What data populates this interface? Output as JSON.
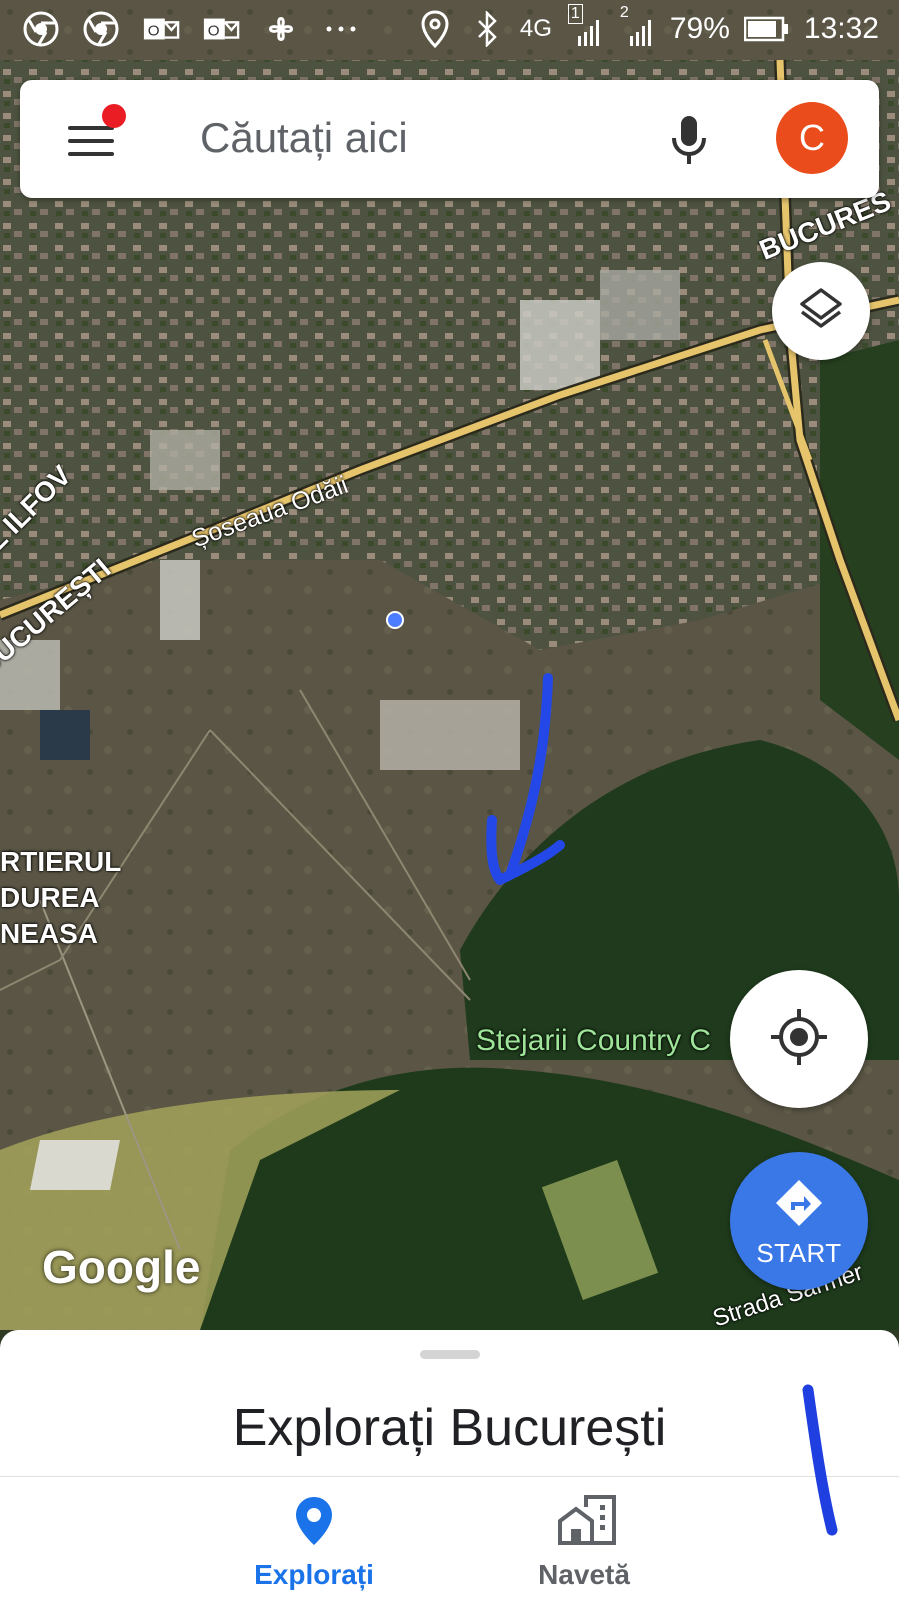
{
  "status_bar": {
    "battery": "79%",
    "time": "13:32",
    "network": "4G",
    "sim1": "1",
    "sim2": "2",
    "left_icons": [
      "chrome-icon",
      "chrome-icon",
      "outlook-icon",
      "outlook-icon",
      "pinwheel-icon",
      "more-dots-icon"
    ],
    "right_icons": [
      "location-icon",
      "bluetooth-icon",
      "signal-icon",
      "battery-icon"
    ]
  },
  "search": {
    "placeholder": "Căutați aici",
    "avatar_letter": "C",
    "menu_notification": true
  },
  "map": {
    "labels": {
      "road_odaii": "Șoseaua Odăii",
      "ilfov": "UL ILFOV",
      "bucuresti_left": "BUCUREȘTI",
      "bucuresti_top": "BUCURES",
      "cartier_line1": "RTIERUL",
      "cartier_line2": "DUREA",
      "cartier_line3": "NEASA",
      "stejarii": "Stejarii Country C",
      "strada": "Strada Sarmer"
    },
    "logo": "Google"
  },
  "buttons": {
    "start_label": "START"
  },
  "sheet": {
    "title": "Explorați București"
  },
  "nav": {
    "explore_label": "Explorați",
    "commute_label": "Navetă"
  },
  "colors": {
    "accent_blue": "#1a73e8",
    "start_blue": "#3b78e7",
    "avatar_orange": "#ea4c1c",
    "notification_red": "#ea1d24"
  }
}
